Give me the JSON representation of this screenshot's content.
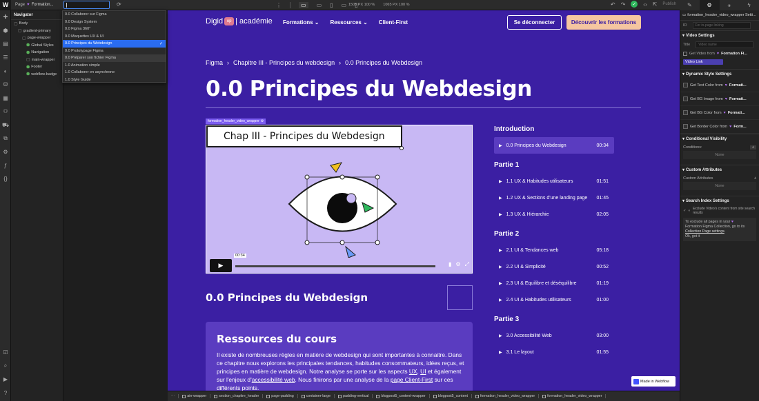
{
  "topbar": {
    "page_label": "Page",
    "page_name": "Formation...",
    "search_value": "",
    "dims_1": "1505",
    "dims_1_unit": "PX",
    "dims_1_zoom": "100 %",
    "dims_2": "1065",
    "dims_2_unit": "PX",
    "dims_2_zoom": "100 %",
    "publish": "Publish"
  },
  "navigator": {
    "title": "Navigator",
    "items": [
      {
        "label": "Body",
        "indent": 0,
        "icon": "square"
      },
      {
        "label": "gradient-primary",
        "indent": 1,
        "icon": "square"
      },
      {
        "label": "page-wrapper",
        "indent": 2,
        "icon": "square"
      },
      {
        "label": "Global Styles",
        "indent": 3,
        "icon": "component"
      },
      {
        "label": "Navigation",
        "indent": 3,
        "icon": "component"
      },
      {
        "label": "main-wrapper",
        "indent": 3,
        "icon": "square"
      },
      {
        "label": "Footer",
        "indent": 3,
        "icon": "component"
      },
      {
        "label": "webflow-badge",
        "indent": 3,
        "icon": "component"
      }
    ]
  },
  "dropdown": {
    "items": [
      {
        "label": "0.0 Collaborer sur Figma",
        "state": ""
      },
      {
        "label": "0.0 Design System",
        "state": ""
      },
      {
        "label": "0.0 Figma 360°",
        "state": ""
      },
      {
        "label": "0.0 Maquettes UX & UI",
        "state": ""
      },
      {
        "label": "0.0 Principes du Webdesign",
        "state": "sel"
      },
      {
        "label": "0.0 Prototypage Figma",
        "state": ""
      },
      {
        "label": "0.0 Préparer son fichier Figma",
        "state": "hl"
      },
      {
        "label": "1.0 Animation simple",
        "state": ""
      },
      {
        "label": "1.0 Collaborer en asynchrone",
        "state": ""
      },
      {
        "label": "1.0 Style Guide",
        "state": ""
      }
    ]
  },
  "site": {
    "logo_left": "Digid",
    "logo_box": "op",
    "logo_right": "| académie",
    "menu": [
      {
        "label": "Formations",
        "dropdown": true
      },
      {
        "label": "Ressources",
        "dropdown": true
      },
      {
        "label": "Client-First",
        "dropdown": false
      }
    ],
    "logout": "Se déconnecter",
    "discover": "Découvrir les formations",
    "breadcrumb": [
      "Figma",
      "Chapitre III - Principes du webdesign",
      "0.0 Principes du Webdesign"
    ],
    "title": "0.0 Principes du Webdesign",
    "video_tag": "formation_header_video_wrapper",
    "video_title": "Chap III - Principes du Webdesign",
    "video_time": "00:34",
    "subtitle": "0.0 Principes du Webdesign",
    "resources": {
      "title": "Ressources du cours",
      "p1": "Il existe de nombreuses règles en matière de webdesign qui sont importantes à connaitre. Dans ce chapitre nous explorons les principales tendances, habitudes consommateurs, idées reçus, et principes en matière de webdesign. Notre analyse se porte sur les aspects ",
      "l1": "UX",
      "p2": ", ",
      "l2": "UI",
      "p3": " et également sur l'enjeux d'",
      "l3": "accessibilité web",
      "p4": ". Nous finirons par une analyse de la ",
      "l4": "page Client-First",
      "p5": " sur ces différents points."
    }
  },
  "toc": [
    {
      "section": "Introduction",
      "items": [
        {
          "label": "0.0 Principes du Webdesign",
          "dur": "00:34",
          "active": true
        }
      ]
    },
    {
      "section": "Partie 1",
      "items": [
        {
          "label": "1.1 UX & Habitudes utilisateurs",
          "dur": "01:51"
        },
        {
          "label": "1.2 UX & Sections d'une landing page",
          "dur": "01:45"
        },
        {
          "label": "1.3 UX & Hiérarchie",
          "dur": "02:05"
        }
      ]
    },
    {
      "section": "Partie 2",
      "items": [
        {
          "label": "2.1 UI & Tendances web",
          "dur": "05:18"
        },
        {
          "label": "2.2 UI & Simplicité",
          "dur": "00:52"
        },
        {
          "label": "2.3 UI & Equilibre et déséquilibre",
          "dur": "01:19"
        },
        {
          "label": "2.4 UI & Habitudes utilisateurs",
          "dur": "01:00"
        }
      ]
    },
    {
      "section": "Partie 3",
      "items": [
        {
          "label": "3.0 Accessibilité Web",
          "dur": "03:00"
        },
        {
          "label": "3.1 Le layout",
          "dur": "01:55"
        }
      ]
    }
  ],
  "badge": "Made in Webflow",
  "crumbbar": [
    "ain-wrapper",
    "section_chapitre_header",
    "page-padding",
    "container-large",
    "padding-vertical",
    "blogpost5_content-wrapper",
    "blogpost5_content",
    "formation_header_video_wrapper",
    "formation_header_video_wrapper"
  ],
  "rpanel": {
    "header": "formation_header_video_wrapper Setti...",
    "id_label": "ID",
    "id_placeholder": "For in-page linking",
    "video_settings": "Video Settings",
    "title_label": "Title",
    "title_placeholder": "Video name",
    "get_video": "Get Video from",
    "get_video_src": "Formation Fi...",
    "video_link": "Video Link",
    "dynamic": "Dynamic Style Settings",
    "dyn_rows": [
      {
        "label": "Get Text Color from",
        "src": "Formati..."
      },
      {
        "label": "Get BG Image from",
        "src": "Formati..."
      },
      {
        "label": "Get BG Color from",
        "src": "Formati..."
      },
      {
        "label": "Get Border Color from",
        "src": "Form..."
      }
    ],
    "cond": "Conditional Visibility",
    "conditions": "Conditions:",
    "none1": "None",
    "custom": "Custom Attributes",
    "custom_label": "Custom Attributes",
    "none2": "None",
    "search": "Search Index Settings",
    "exclude": "Exclude Video's content from site search results",
    "note_1": "To exclude all pages in your",
    "note_2": "Formation Figma Collection, go to its",
    "note_link": "Collection Page settings",
    "note_ok": "Ok, got it"
  }
}
